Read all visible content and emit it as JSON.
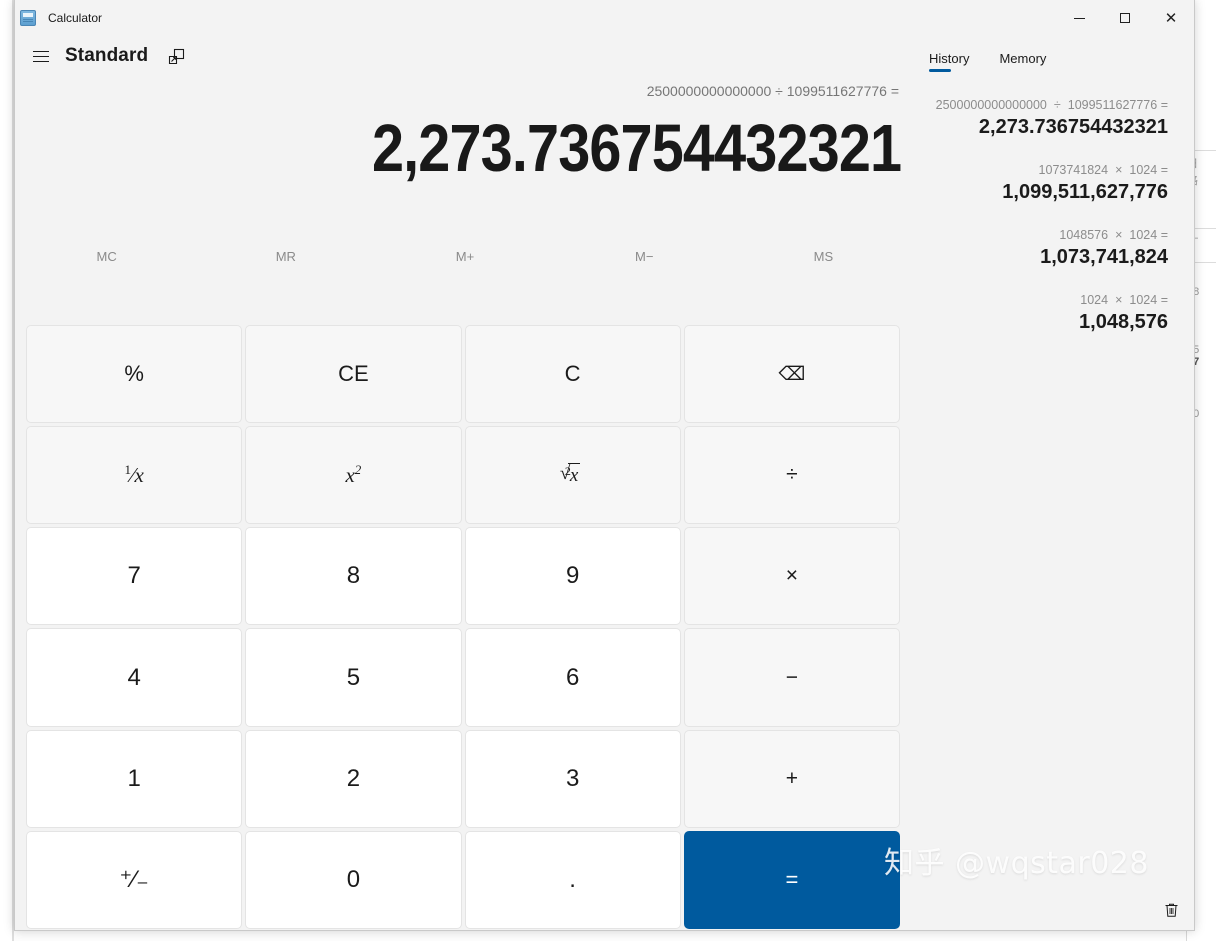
{
  "window": {
    "app_title": "Calculator",
    "app_icon": "calculator-icon",
    "minimize_label": "—",
    "maximize_label": "☐",
    "close_label": "✕"
  },
  "header": {
    "menu_icon": "hamburger-menu-icon",
    "mode_title": "Standard",
    "keep_on_top_icon": "keep-on-top-icon"
  },
  "display": {
    "expression": "2500000000000000 ÷ 1099511627776 =",
    "result": "2,273.736754432321"
  },
  "memory": {
    "buttons": [
      {
        "label": "MC",
        "name": "memory-clear"
      },
      {
        "label": "MR",
        "name": "memory-recall"
      },
      {
        "label": "M+",
        "name": "memory-add"
      },
      {
        "label": "M−",
        "name": "memory-subtract"
      },
      {
        "label": "MS",
        "name": "memory-store"
      }
    ]
  },
  "keypad": {
    "percent": "%",
    "clear_entry": "CE",
    "clear": "C",
    "backspace_icon": "backspace-icon",
    "backspace_glyph": "⌫",
    "reciprocal_num": "1",
    "reciprocal_den": "x",
    "square_base": "x",
    "square_exp": "2",
    "sqrt_index": "2",
    "sqrt_radicand": "x",
    "divide": "÷",
    "seven": "7",
    "eight": "8",
    "nine": "9",
    "multiply": "×",
    "four": "4",
    "five": "5",
    "six": "6",
    "subtract": "−",
    "one": "1",
    "two": "2",
    "three": "3",
    "add": "+",
    "plus_minus": "⁺⁄₋",
    "zero": "0",
    "decimal": ".",
    "equals": "="
  },
  "side_panel": {
    "tabs": [
      {
        "label": "History",
        "active": true
      },
      {
        "label": "Memory",
        "active": false
      }
    ],
    "clear_history_icon": "trash-icon",
    "history": [
      {
        "left": "2500000000000000",
        "operator": "÷",
        "right": "1099511627776",
        "equals": "=",
        "result": "2,273.736754432321"
      },
      {
        "left": "1073741824",
        "operator": "×",
        "right": "1024",
        "equals": "=",
        "result": "1,099,511,627,776"
      },
      {
        "left": "1048576",
        "operator": "×",
        "right": "1024",
        "equals": "=",
        "result": "1,073,741,824"
      },
      {
        "left": "1024",
        "operator": "×",
        "right": "1024",
        "equals": "=",
        "result": "1,048,576"
      }
    ]
  },
  "watermark": {
    "text": "知乎 @wqstar028"
  },
  "colors": {
    "accent": "#005a9e",
    "window_bg": "#f3f3f3",
    "key_number_bg": "#ffffff",
    "key_function_bg": "#f7f7f7",
    "text_primary": "#1b1b1b",
    "text_secondary": "#8c8c8c"
  }
}
